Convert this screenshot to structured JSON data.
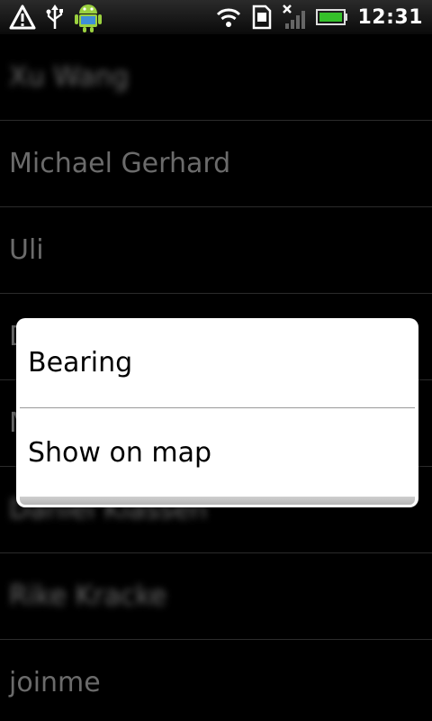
{
  "status_bar": {
    "time": "12:31",
    "icons": [
      "warning-icon",
      "usb-icon",
      "android-icon",
      "wifi-icon",
      "sim-icon",
      "no-signal-icon",
      "signal-bars-icon",
      "battery-icon"
    ]
  },
  "contacts": [
    {
      "name": "Xu Wang",
      "blurred": true
    },
    {
      "name": "Michael Gerhard",
      "blurred": false
    },
    {
      "name": "Uli",
      "blurred": false
    },
    {
      "name": "D",
      "blurred": false
    },
    {
      "name": "M",
      "blurred": false
    },
    {
      "name": "Daniel Klassen",
      "blurred": true
    },
    {
      "name": "Rike Kracke",
      "blurred": true
    },
    {
      "name": "joinme",
      "blurred": false
    }
  ],
  "context_menu": {
    "items": [
      {
        "label": "Bearing"
      },
      {
        "label": "Show on map"
      }
    ]
  },
  "colors": {
    "background": "#000000",
    "list_text": "#6b6b6b",
    "menu_background": "#ffffff",
    "menu_text": "#000000",
    "battery_green": "#35c02a"
  }
}
